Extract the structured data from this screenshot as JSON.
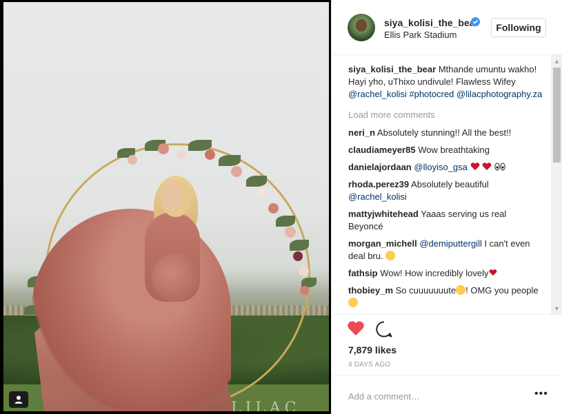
{
  "post": {
    "username": "siya_kolisi_the_bear",
    "location": "Ellis Park Stadium",
    "follow_label": "Following",
    "photo_watermark": "LILAC",
    "caption": {
      "user": "siya_kolisi_the_bear",
      "text_before": "Mthande umuntu wakho! Hayi yho, uThixo undivule! Flawless Wifey ",
      "mention1": "@rachel_kolisi",
      "hashtag": "#photocred",
      "mention2": "@lilacphotography.za"
    },
    "load_more": "Load more comments",
    "comments": [
      {
        "user": "neri_n",
        "text": "Absolutely stunning!! All the best!!"
      },
      {
        "user": "claudiameyer85",
        "text": "Wow breathtaking"
      },
      {
        "user": "danielajordaan",
        "mention": "@lloyiso_gsa",
        "text": ""
      },
      {
        "user": "rhoda.perez39",
        "text": "Absolutely beautiful ",
        "mention": "@rachel_kolisi"
      },
      {
        "user": "mattyjwhitehead",
        "text": "Yaaas serving us real Beyoncé"
      },
      {
        "user": "morgan_michell",
        "mention": "@demiputtergill",
        "text": " I can't even deal bru. "
      },
      {
        "user": "fathsip",
        "text": "Wow! How incredibly lovely"
      },
      {
        "user": "thobiey_m",
        "text": "So cuuuuuuute",
        "text2": "! OMG you people"
      }
    ],
    "likes": "7,879 likes",
    "time": "4 DAYS AGO",
    "add_comment_placeholder": "Add a comment…",
    "more_options": "•••"
  },
  "icons": {
    "heart": "heart-icon",
    "comment": "comment-icon",
    "verified": "verified-badge-icon",
    "user_tag": "user-tag-icon"
  },
  "colors": {
    "heart": "#ed4956",
    "link": "#003569",
    "verified": "#3897f0",
    "muted": "#999999"
  }
}
